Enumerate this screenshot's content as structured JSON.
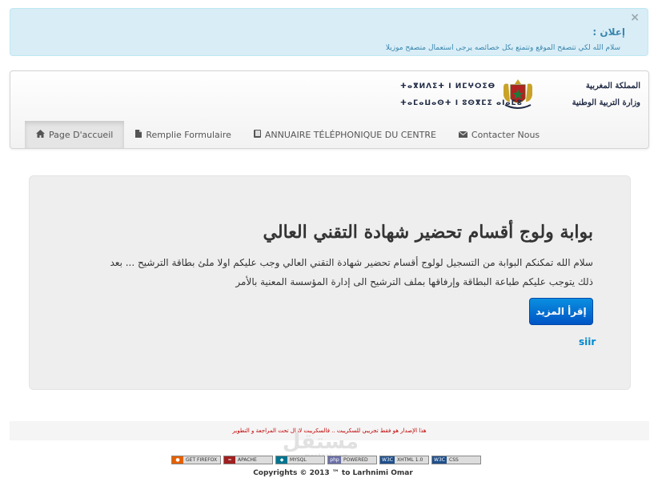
{
  "alert": {
    "close": "×",
    "title": "إعلان :",
    "message": "سلام الله لكي تتصفح الموقع وتتمتع بكل خصائصه يرجى استعمال متصفح موزيلا"
  },
  "header": {
    "ministry_ar_line1": "المملكة المغربية",
    "ministry_ar_line2": "وزارة التربية الوطنية",
    "ministry_tz_line1": "ⵜⴰⴳⵍⴷⵉⵜ ⵏ ⵍⵎⵖⵔⵉⴱ",
    "ministry_tz_line2": "ⵜⴰⵎⴰⵡⴰⵙⵜ ⵏ ⵓⵙⴳⵎⵉ ⴰⵏⴰⵎⵓ"
  },
  "nav": {
    "items": [
      {
        "label": "Page D'accueil",
        "icon": "home-icon",
        "active": true
      },
      {
        "label": "Remplie Formulaire",
        "icon": "file-icon",
        "active": false
      },
      {
        "label": "ANNUAIRE TÉLÉPHONIQUE DU CENTRE",
        "icon": "book-icon",
        "active": false
      },
      {
        "label": "Contacter Nous",
        "icon": "envelope-icon",
        "active": false
      }
    ]
  },
  "hero": {
    "title": "بوابة ولوج أقسام تحضير شهادة التقني العالي",
    "paragraph_line1": "سلام الله تمكنكم البوابة من التسجيل لولوج أقسام تحضير شهادة التقني العالي وجب عليكم اولا ملئ بطاقة الترشيح ... بعد",
    "paragraph_line2": "ذلك يتوجب عليكم طباعة البطاقة وإرفاقها بملف الترشيح الى إدارة المؤسسة المعنية بالأمر",
    "button_label": "إقرأ المزيد",
    "link": "siir"
  },
  "footer": {
    "note": "هذا الإصدار هو فقط تجريبي للسكريبت .. فالسكريبت لازال تحت المراجعة و التطوير",
    "watermark": "مستقل",
    "watermark_sub": "mostaql.com",
    "badges": [
      {
        "left": "●",
        "right": "GET FIREFOX",
        "color": "#e66000"
      },
      {
        "left": "≈",
        "right": "APACHE",
        "color": "#a02020"
      },
      {
        "left": "◆",
        "right": "MYSQL",
        "color": "#00758f"
      },
      {
        "left": "php",
        "right": "POWERED",
        "color": "#6a6fa6"
      },
      {
        "left": "W3C",
        "right": "XHTML 1.0",
        "color": "#1f4f8b"
      },
      {
        "left": "W3C",
        "right": "CSS",
        "color": "#1f4f8b"
      }
    ],
    "copyright": "Copyrights © 2013 ™ to Larhnimi Omar"
  }
}
